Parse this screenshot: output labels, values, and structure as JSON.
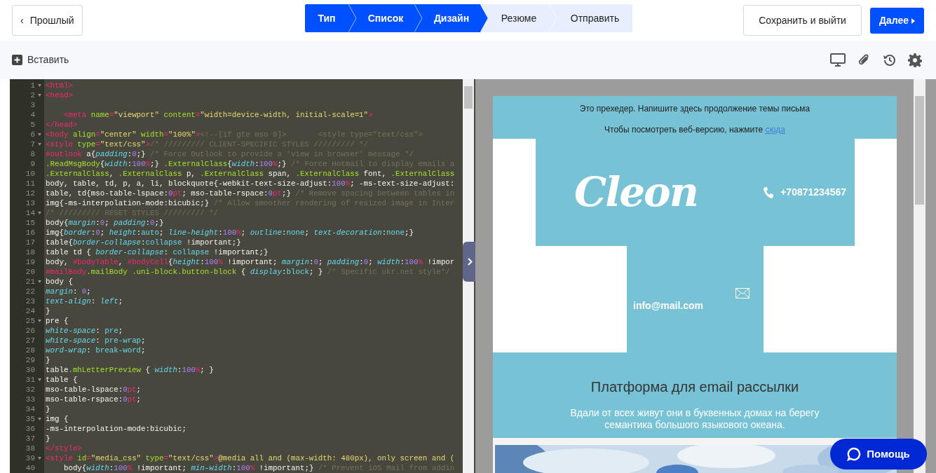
{
  "header": {
    "back_button": {
      "icon": "‹",
      "label": "Прошлый"
    },
    "steps": [
      {
        "label": "Тип",
        "completed": true
      },
      {
        "label": "Список",
        "completed": true
      },
      {
        "label": "Дизайн",
        "completed": true
      },
      {
        "label": "Резюме",
        "completed": false
      },
      {
        "label": "Отправить",
        "completed": false
      }
    ],
    "save_button": "Сохранить и выйти",
    "next_button": "Далее"
  },
  "toolbar": {
    "insert_button": "Вставить"
  },
  "editor": {
    "lines": [
      {
        "number": "1",
        "foldable": true,
        "tokens": [
          {
            "kind": "tag",
            "text": "<html>"
          }
        ]
      },
      {
        "number": "2",
        "foldable": true,
        "tokens": [
          {
            "kind": "tag",
            "text": "<head>"
          }
        ]
      },
      {
        "number": "3",
        "foldable": false
      },
      {
        "number": "4",
        "foldable": false,
        "tokens": [
          {
            "kind": "tag",
            "text": "    <meta"
          },
          {
            "kind": "attr",
            "text": " name"
          },
          {
            "kind": "tag",
            "text": "="
          },
          {
            "kind": "string",
            "text": "\"viewport\""
          },
          {
            "kind": "attr",
            "text": " content"
          },
          {
            "kind": "tag",
            "text": "="
          },
          {
            "kind": "string",
            "text": "\"width=device-width, initial-scale=1\""
          },
          {
            "kind": "tag",
            "text": ">"
          }
        ]
      },
      {
        "number": "5",
        "foldable": false,
        "tokens": [
          {
            "kind": "tag",
            "text": "</head>"
          }
        ]
      },
      {
        "number": "6",
        "foldable": true,
        "tokens": [
          {
            "kind": "tag",
            "text": "<body"
          },
          {
            "kind": "attr",
            "text": " align"
          },
          {
            "kind": "tag",
            "text": "="
          },
          {
            "kind": "string",
            "text": "\"center\""
          },
          {
            "kind": "attr",
            "text": " width"
          },
          {
            "kind": "tag",
            "text": "="
          },
          {
            "kind": "string",
            "text": "\"100%\""
          },
          {
            "kind": "tag",
            "text": ">"
          },
          {
            "kind": "comment",
            "text": "<!--[if gte mso 9]>       <style type=\"text/css\">"
          }
        ]
      },
      {
        "number": "7",
        "foldable": true,
        "tokens": [
          {
            "kind": "tag",
            "text": "<style"
          },
          {
            "kind": "attr",
            "text": " type"
          },
          {
            "kind": "tag",
            "text": "="
          },
          {
            "kind": "string",
            "text": "\"text/css\""
          },
          {
            "kind": "tag",
            "text": ">"
          },
          {
            "kind": "comment",
            "text": "/* ///////// CLIENT-SPECIFIC STYLES ///////// */"
          }
        ]
      },
      {
        "number": "8",
        "foldable": false,
        "tokens": [
          {
            "kind": "id",
            "text": "#outlook"
          },
          {
            "kind": "plain",
            "text": " a{"
          },
          {
            "kind": "property",
            "text": "padding"
          },
          {
            "kind": "plain",
            "text": ":"
          },
          {
            "kind": "number",
            "text": "0"
          },
          {
            "kind": "plain",
            "text": ";}"
          },
          {
            "kind": "comment",
            "text": " /* Force Outlook to provide a 'view in browser' message */"
          }
        ]
      },
      {
        "number": "9",
        "foldable": false,
        "tokens": [
          {
            "kind": "class",
            "text": ".ReadMsgBody"
          },
          {
            "kind": "plain",
            "text": "{"
          },
          {
            "kind": "property",
            "text": "width"
          },
          {
            "kind": "plain",
            "text": ":"
          },
          {
            "kind": "number",
            "text": "100"
          },
          {
            "kind": "unit",
            "text": "%"
          },
          {
            "kind": "plain",
            "text": ";} "
          },
          {
            "kind": "class",
            "text": ".ExternalClass"
          },
          {
            "kind": "plain",
            "text": "{"
          },
          {
            "kind": "property",
            "text": "width"
          },
          {
            "kind": "plain",
            "text": ":"
          },
          {
            "kind": "number",
            "text": "100"
          },
          {
            "kind": "unit",
            "text": "%"
          },
          {
            "kind": "plain",
            "text": ";}"
          },
          {
            "kind": "comment",
            "text": " /* Force Hotmail to display emails a"
          }
        ]
      },
      {
        "number": "10",
        "foldable": false,
        "tokens": [
          {
            "kind": "class",
            "text": ".ExternalClass"
          },
          {
            "kind": "plain",
            "text": ", "
          },
          {
            "kind": "class",
            "text": ".ExternalClass"
          },
          {
            "kind": "plain",
            "text": " p, "
          },
          {
            "kind": "class",
            "text": ".ExternalClass"
          },
          {
            "kind": "plain",
            "text": " span, "
          },
          {
            "kind": "class",
            "text": ".ExternalClass"
          },
          {
            "kind": "plain",
            "text": " font, "
          },
          {
            "kind": "class",
            "text": ".ExternalClass"
          }
        ]
      },
      {
        "number": "11",
        "foldable": false,
        "tokens": [
          {
            "kind": "plain",
            "text": "body, table, td, p, a, li, blockquote{-webkit-text-size-adjust:"
          },
          {
            "kind": "number",
            "text": "100"
          },
          {
            "kind": "unit",
            "text": "%"
          },
          {
            "kind": "plain",
            "text": "; -ms-text-size-adjust:"
          }
        ]
      },
      {
        "number": "12",
        "foldable": false,
        "tokens": [
          {
            "kind": "plain",
            "text": "table, td{mso-table-lspace:"
          },
          {
            "kind": "number",
            "text": "0"
          },
          {
            "kind": "unit",
            "text": "pt"
          },
          {
            "kind": "plain",
            "text": "; mso-table-rspace:"
          },
          {
            "kind": "number",
            "text": "0"
          },
          {
            "kind": "unit",
            "text": "pt"
          },
          {
            "kind": "plain",
            "text": ";}"
          },
          {
            "kind": "comment",
            "text": " /* Remove spacing between tables in"
          }
        ]
      },
      {
        "number": "13",
        "foldable": false,
        "tokens": [
          {
            "kind": "plain",
            "text": "img{-ms-interpolation-mode:bicubic;}"
          },
          {
            "kind": "comment",
            "text": " /* Allow smoother rendering of resized image in Inter"
          }
        ]
      },
      {
        "number": "14",
        "foldable": true,
        "tokens": [
          {
            "kind": "comment",
            "text": "/* ///////// RESET STYLES ///////// */"
          }
        ]
      },
      {
        "number": "15",
        "foldable": false,
        "tokens": [
          {
            "kind": "plain",
            "text": "body{"
          },
          {
            "kind": "property",
            "text": "margin"
          },
          {
            "kind": "plain",
            "text": ":"
          },
          {
            "kind": "number",
            "text": "0"
          },
          {
            "kind": "plain",
            "text": "; "
          },
          {
            "kind": "property",
            "text": "padding"
          },
          {
            "kind": "plain",
            "text": ":"
          },
          {
            "kind": "number",
            "text": "0"
          },
          {
            "kind": "plain",
            "text": ";}"
          }
        ]
      },
      {
        "number": "16",
        "foldable": false,
        "tokens": [
          {
            "kind": "plain",
            "text": "img{"
          },
          {
            "kind": "property",
            "text": "border"
          },
          {
            "kind": "plain",
            "text": ":"
          },
          {
            "kind": "number",
            "text": "0"
          },
          {
            "kind": "plain",
            "text": "; "
          },
          {
            "kind": "property",
            "text": "height"
          },
          {
            "kind": "plain",
            "text": ":"
          },
          {
            "kind": "value",
            "text": "auto"
          },
          {
            "kind": "plain",
            "text": "; "
          },
          {
            "kind": "property",
            "text": "line-height"
          },
          {
            "kind": "plain",
            "text": ":"
          },
          {
            "kind": "number",
            "text": "100"
          },
          {
            "kind": "unit",
            "text": "%"
          },
          {
            "kind": "plain",
            "text": "; "
          },
          {
            "kind": "property",
            "text": "outline"
          },
          {
            "kind": "plain",
            "text": ":"
          },
          {
            "kind": "value",
            "text": "none"
          },
          {
            "kind": "plain",
            "text": "; "
          },
          {
            "kind": "property",
            "text": "text-decoration"
          },
          {
            "kind": "plain",
            "text": ":"
          },
          {
            "kind": "value",
            "text": "none"
          },
          {
            "kind": "plain",
            "text": ";}"
          }
        ]
      },
      {
        "number": "17",
        "foldable": false,
        "tokens": [
          {
            "kind": "plain",
            "text": "table{"
          },
          {
            "kind": "property",
            "text": "border-collapse"
          },
          {
            "kind": "plain",
            "text": ":"
          },
          {
            "kind": "value",
            "text": "collapse"
          },
          {
            "kind": "plain",
            "text": " !important;}"
          }
        ]
      },
      {
        "number": "18",
        "foldable": false,
        "tokens": [
          {
            "kind": "plain",
            "text": "table td { "
          },
          {
            "kind": "property",
            "text": "border-collapse"
          },
          {
            "kind": "plain",
            "text": ": "
          },
          {
            "kind": "value",
            "text": "collapse"
          },
          {
            "kind": "plain",
            "text": " !important;}"
          }
        ]
      },
      {
        "number": "19",
        "foldable": false,
        "tokens": [
          {
            "kind": "plain",
            "text": "body, "
          },
          {
            "kind": "id",
            "text": "#bodyTable"
          },
          {
            "kind": "plain",
            "text": ", "
          },
          {
            "kind": "id",
            "text": "#bodyCell"
          },
          {
            "kind": "plain",
            "text": "{"
          },
          {
            "kind": "property",
            "text": "height"
          },
          {
            "kind": "plain",
            "text": ":"
          },
          {
            "kind": "number",
            "text": "100"
          },
          {
            "kind": "unit",
            "text": "%"
          },
          {
            "kind": "plain",
            "text": " !important; "
          },
          {
            "kind": "property",
            "text": "margin"
          },
          {
            "kind": "plain",
            "text": ":"
          },
          {
            "kind": "number",
            "text": "0"
          },
          {
            "kind": "plain",
            "text": "; "
          },
          {
            "kind": "property",
            "text": "padding"
          },
          {
            "kind": "plain",
            "text": ":"
          },
          {
            "kind": "number",
            "text": "0"
          },
          {
            "kind": "plain",
            "text": "; "
          },
          {
            "kind": "property",
            "text": "width"
          },
          {
            "kind": "plain",
            "text": ":"
          },
          {
            "kind": "number",
            "text": "100"
          },
          {
            "kind": "unit",
            "text": "%"
          },
          {
            "kind": "plain",
            "text": " !impor"
          }
        ]
      },
      {
        "number": "20",
        "foldable": false,
        "tokens": [
          {
            "kind": "id",
            "text": "#mailBody"
          },
          {
            "kind": "class",
            "text": ".mailBody"
          },
          {
            "kind": "class",
            "text": " .uni-block.button-block"
          },
          {
            "kind": "plain",
            "text": " { "
          },
          {
            "kind": "property",
            "text": "display"
          },
          {
            "kind": "plain",
            "text": ":"
          },
          {
            "kind": "value",
            "text": "block"
          },
          {
            "kind": "plain",
            "text": "; }"
          },
          {
            "kind": "comment",
            "text": " /* Specific ukr.net style*/"
          }
        ]
      },
      {
        "number": "21",
        "foldable": true,
        "tokens": [
          {
            "kind": "plain",
            "text": "body {"
          }
        ]
      },
      {
        "number": "22",
        "foldable": false,
        "tokens": [
          {
            "kind": "property",
            "text": "margin"
          },
          {
            "kind": "plain",
            "text": ": "
          },
          {
            "kind": "number",
            "text": "0"
          },
          {
            "kind": "plain",
            "text": ";"
          }
        ]
      },
      {
        "number": "23",
        "foldable": false,
        "tokens": [
          {
            "kind": "property",
            "text": "text-align"
          },
          {
            "kind": "plain",
            "text": ": "
          },
          {
            "kind": "property",
            "text": "left"
          },
          {
            "kind": "plain",
            "text": ";"
          }
        ]
      },
      {
        "number": "24",
        "foldable": false,
        "tokens": [
          {
            "kind": "plain",
            "text": "}"
          }
        ]
      },
      {
        "number": "25",
        "foldable": true,
        "tokens": [
          {
            "kind": "plain",
            "text": "pre {"
          }
        ]
      },
      {
        "number": "26",
        "foldable": false,
        "tokens": [
          {
            "kind": "property",
            "text": "white-space"
          },
          {
            "kind": "plain",
            "text": ": "
          },
          {
            "kind": "value",
            "text": "pre"
          },
          {
            "kind": "plain",
            "text": ";"
          }
        ]
      },
      {
        "number": "27",
        "foldable": false,
        "tokens": [
          {
            "kind": "property",
            "text": "white-space"
          },
          {
            "kind": "plain",
            "text": ": "
          },
          {
            "kind": "value",
            "text": "pre-wrap"
          },
          {
            "kind": "plain",
            "text": ";"
          }
        ]
      },
      {
        "number": "28",
        "foldable": false,
        "tokens": [
          {
            "kind": "property",
            "text": "word-wrap"
          },
          {
            "kind": "plain",
            "text": ": "
          },
          {
            "kind": "value",
            "text": "break-word"
          },
          {
            "kind": "plain",
            "text": ";"
          }
        ]
      },
      {
        "number": "29",
        "foldable": false,
        "tokens": [
          {
            "kind": "plain",
            "text": "}"
          }
        ]
      },
      {
        "number": "30",
        "foldable": false,
        "tokens": [
          {
            "kind": "plain",
            "text": "table"
          },
          {
            "kind": "class",
            "text": ".mhLetterPreview"
          },
          {
            "kind": "plain",
            "text": " { "
          },
          {
            "kind": "property",
            "text": "width"
          },
          {
            "kind": "plain",
            "text": ":"
          },
          {
            "kind": "number",
            "text": "100"
          },
          {
            "kind": "unit",
            "text": "%"
          },
          {
            "kind": "plain",
            "text": "; }"
          }
        ]
      },
      {
        "number": "31",
        "foldable": true,
        "tokens": [
          {
            "kind": "plain",
            "text": "table {"
          }
        ]
      },
      {
        "number": "32",
        "foldable": false,
        "tokens": [
          {
            "kind": "plain",
            "text": "mso-table-lspace:"
          },
          {
            "kind": "number",
            "text": "0"
          },
          {
            "kind": "unit",
            "text": "pt"
          },
          {
            "kind": "plain",
            "text": ";"
          }
        ]
      },
      {
        "number": "33",
        "foldable": false,
        "tokens": [
          {
            "kind": "plain",
            "text": "mso-table-rspace:"
          },
          {
            "kind": "number",
            "text": "0"
          },
          {
            "kind": "unit",
            "text": "pt"
          },
          {
            "kind": "plain",
            "text": ";"
          }
        ]
      },
      {
        "number": "34",
        "foldable": false,
        "tokens": [
          {
            "kind": "plain",
            "text": "}"
          }
        ]
      },
      {
        "number": "35",
        "foldable": true,
        "tokens": [
          {
            "kind": "plain",
            "text": "img {"
          }
        ]
      },
      {
        "number": "36",
        "foldable": false,
        "tokens": [
          {
            "kind": "plain",
            "text": "-ms-interpolation-mode:bicubic;"
          }
        ]
      },
      {
        "number": "37",
        "foldable": false,
        "tokens": [
          {
            "kind": "plain",
            "text": "}"
          }
        ]
      },
      {
        "number": "38",
        "foldable": false,
        "tokens": [
          {
            "kind": "tag",
            "text": "</style>"
          }
        ]
      },
      {
        "number": "39",
        "foldable": true,
        "tokens": [
          {
            "kind": "tag",
            "text": "<style"
          },
          {
            "kind": "attr",
            "text": " id"
          },
          {
            "kind": "tag",
            "text": "="
          },
          {
            "kind": "string",
            "text": "\"media_css\""
          },
          {
            "kind": "attr",
            "text": " type"
          },
          {
            "kind": "tag",
            "text": "="
          },
          {
            "kind": "string",
            "text": "\"text/css\""
          },
          {
            "kind": "tag",
            "text": ">"
          },
          {
            "kind": "string",
            "text": "@media all and (max-width: 480px), only screen and ("
          }
        ]
      },
      {
        "number": "40",
        "foldable": false,
        "tokens": [
          {
            "kind": "plain",
            "text": "    body{"
          },
          {
            "kind": "property",
            "text": "width"
          },
          {
            "kind": "plain",
            "text": ":"
          },
          {
            "kind": "number",
            "text": "100"
          },
          {
            "kind": "unit",
            "text": "%"
          },
          {
            "kind": "plain",
            "text": " !important; "
          },
          {
            "kind": "property",
            "text": "min-width"
          },
          {
            "kind": "plain",
            "text": ":"
          },
          {
            "kind": "number",
            "text": "100"
          },
          {
            "kind": "unit",
            "text": "%"
          },
          {
            "kind": "plain",
            "text": " !important;}"
          },
          {
            "kind": "comment",
            "text": " /* Prevent iOS Mail from addin"
          }
        ]
      }
    ]
  },
  "preview": {
    "preheader": "Это прехедер. Напишите здесь продолжение темы письма",
    "web_version": {
      "text": "Чтобы посмотреть веб-версию, нажмите ",
      "link": "сюда"
    },
    "logo": "Cleon",
    "phone": "+70871234567",
    "email": "info@mail.com",
    "heading": "Платформа для email рассылки",
    "body": "Вдали от всех живут они в буквенных домах на берегу семантика большого языкового океана."
  },
  "help_button": "Помощь"
}
